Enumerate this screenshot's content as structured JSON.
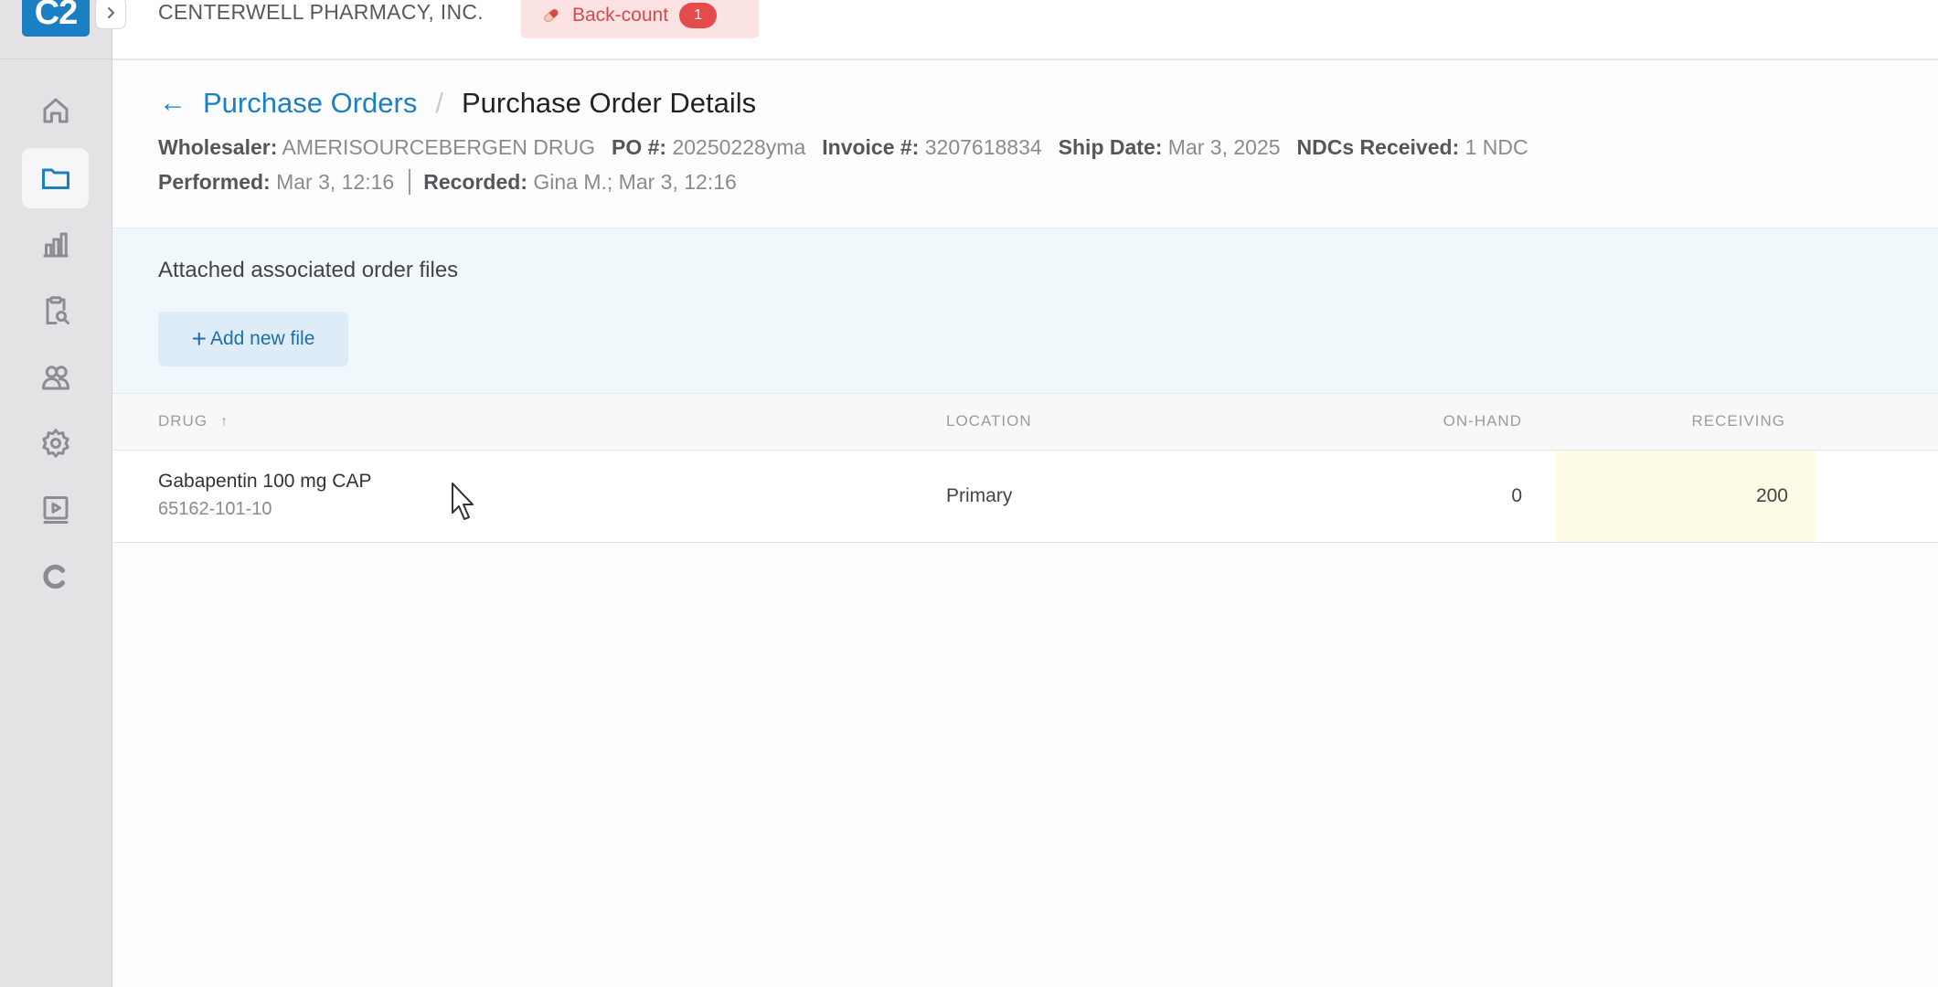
{
  "sidebar": {
    "logo": "C2",
    "items": [
      {
        "icon": "home-icon",
        "active": false
      },
      {
        "icon": "folder-icon",
        "active": true
      },
      {
        "icon": "bar-chart-icon",
        "active": false
      },
      {
        "icon": "clipboard-search-icon",
        "active": false
      },
      {
        "icon": "users-icon",
        "active": false
      },
      {
        "icon": "gear-icon",
        "active": false
      },
      {
        "icon": "video-icon",
        "active": false
      },
      {
        "icon": "c-logo-icon",
        "active": false
      }
    ]
  },
  "header": {
    "company": "CENTERWELL PHARMACY, INC.",
    "backcount": {
      "label": "Back-count",
      "count": "1"
    }
  },
  "breadcrumb": {
    "back_arrow": "←",
    "parent": "Purchase Orders",
    "separator": "/",
    "current": "Purchase Order Details"
  },
  "meta": {
    "wholesaler_label": "Wholesaler:",
    "wholesaler": "AMERISOURCEBERGEN DRUG",
    "po_label": "PO #:",
    "po": "20250228yma",
    "invoice_label": "Invoice #:",
    "invoice": "3207618834",
    "ship_label": "Ship Date:",
    "ship_date": "Mar 3, 2025",
    "ndcs_label": "NDCs Received:",
    "ndcs": "1 NDC",
    "performed_label": "Performed:",
    "performed": "Mar 3, 12:16",
    "recorded_label": "Recorded:",
    "recorded": "Gina M.; Mar 3, 12:16"
  },
  "files": {
    "title": "Attached associated order files",
    "add_button": "Add new file",
    "add_plus": "+"
  },
  "table": {
    "columns": {
      "drug": "DRUG",
      "sort_arrow": "↑",
      "location": "LOCATION",
      "on_hand": "ON-HAND",
      "receiving": "RECEIVING"
    },
    "rows": [
      {
        "drug": "Gabapentin 100 mg CAP",
        "ndc": "65162-101-10",
        "location": "Primary",
        "on_hand": "0",
        "receiving": "200"
      }
    ]
  },
  "colors": {
    "accent": "#1b7fc3",
    "badge_red": "#e54b4b",
    "backcount_bg": "#fbe3e3",
    "files_bg": "#f1f8fc",
    "receiving_bg": "#fdfbe6"
  }
}
